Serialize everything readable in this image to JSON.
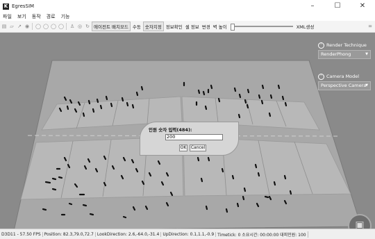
{
  "window": {
    "title": "EgresSIM",
    "app_icon": "app-logo-icon",
    "min": "–",
    "max": "☐",
    "close": "✕"
  },
  "menu": [
    "파일",
    "보기",
    "동작",
    "경로",
    "기능"
  ],
  "toolbar": {
    "icons": [
      "save-icon",
      "open-icon",
      "cursor-icon",
      "record-icon",
      "circle-icon-1",
      "circle-icon-2",
      "circle-icon-3",
      "circle-icon-4",
      "person-icon",
      "target-icon",
      "refresh-icon"
    ],
    "agent_btn": "에이전트 배치모드",
    "manual": "수동",
    "numeric_btn": "숫자지정",
    "info": "정보확인",
    "cell_info": "셀 정보",
    "change": "변경",
    "wall_height": "벽 높이",
    "xml": "XML생성",
    "end": "="
  },
  "render_panel": {
    "title": "Render Technique",
    "value": "RenderPhong"
  },
  "camera_panel": {
    "title": "Camera Model",
    "value": "Perspective Camera"
  },
  "dialog": {
    "title": "인원 숫자 입력(484):",
    "value": "200",
    "ok": "OK",
    "cancel": "Cancel"
  },
  "status": [
    "D3D11 - 57.50 FPS",
    "Position: 82.3,79.0,72.7",
    "LookDirection: 2.6,-64.0,-31.4",
    "UpDirection: 0.1,1.1,-0.9",
    "Timetick: 0  소요시간: 00:00:00  대피인원: 100"
  ]
}
